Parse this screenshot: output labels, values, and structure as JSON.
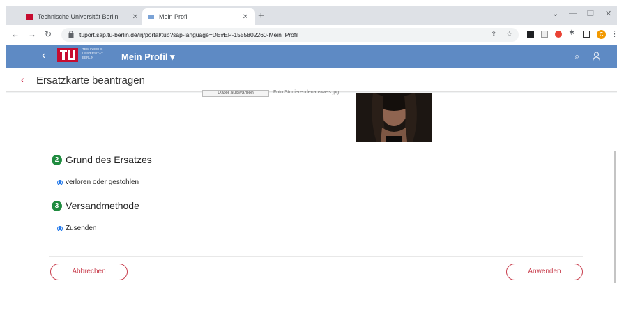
{
  "browser": {
    "tabs": [
      {
        "title": "Technische Universität Berlin",
        "active": false
      },
      {
        "title": "Mein Profil",
        "active": true
      }
    ],
    "new_tab": "+",
    "address_url": "tuport.sap.tu-berlin.de/irj/portal/tub?sap-language=DE#EP-1555802260-Mein_Profil",
    "profile_initial": "C"
  },
  "shell": {
    "logo_lines": [
      "TECHNISCHE",
      "UNIVERSITÄT",
      "BERLIN"
    ],
    "title": "Mein Profil ▾"
  },
  "page": {
    "title": "Ersatzkarte beantragen",
    "upload_button": "Datei auswählen",
    "upload_hint": "Foto Studierendenausweis.jpg"
  },
  "sections": [
    {
      "number": "2",
      "title": "Grund des Ersatzes",
      "option": "verloren oder gestohlen"
    },
    {
      "number": "3",
      "title": "Versandmethode",
      "option": "Zusenden"
    }
  ],
  "actions": {
    "cancel": "Abbrechen",
    "apply": "Anwenden"
  },
  "colors": {
    "shell_blue": "#5e8ac4",
    "tu_red": "#c60c30",
    "button_red": "#c9404f",
    "badge_green": "#1f8b3f"
  }
}
